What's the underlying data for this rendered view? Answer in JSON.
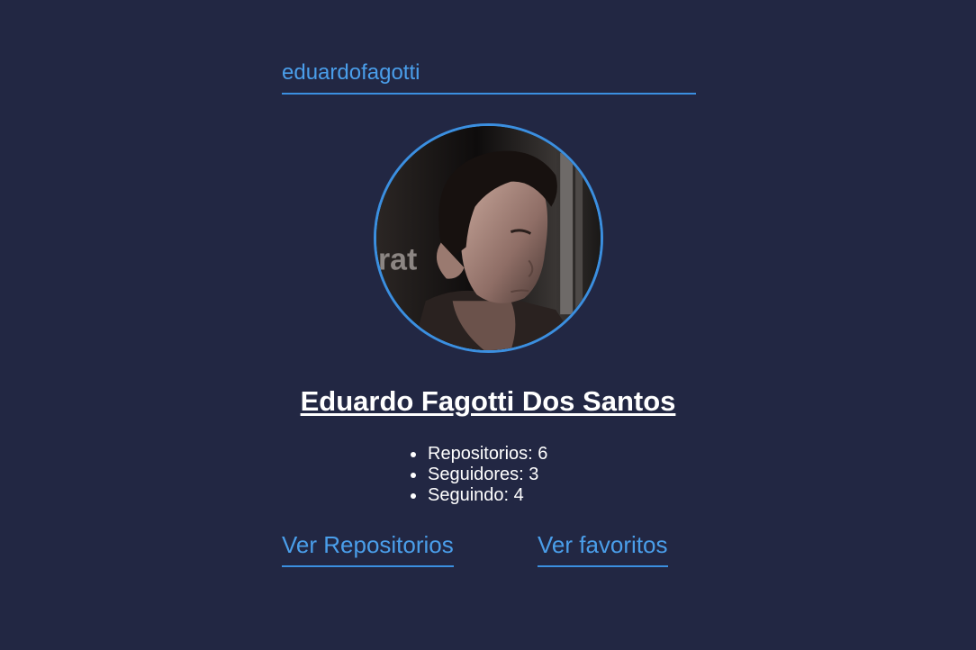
{
  "search": {
    "value": "eduardofagotti",
    "placeholder": ""
  },
  "profile": {
    "name": "Eduardo Fagotti Dos Santos",
    "avatar_icon": "user-avatar-photo",
    "stats": [
      {
        "label": "Repositorios: 6"
      },
      {
        "label": "Seguidores: 3"
      },
      {
        "label": "Seguindo: 4"
      }
    ]
  },
  "links": {
    "repositories": "Ver Repositorios",
    "favorites": "Ver favoritos"
  },
  "colors": {
    "background": "#222743",
    "accent": "#3b8fe0",
    "link_text": "#4a9eea",
    "text": "#ffffff"
  }
}
